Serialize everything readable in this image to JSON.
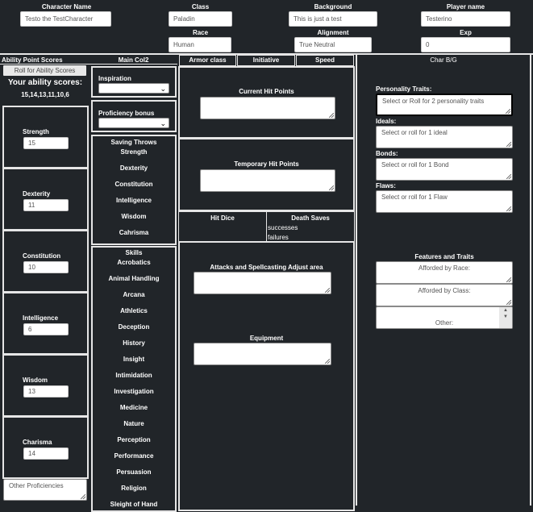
{
  "header": {
    "character_name": {
      "label": "Character Name",
      "value": "Testo the TestCharacter"
    },
    "class": {
      "label": "Class",
      "value": "Paladin"
    },
    "background": {
      "label": "Background",
      "value": "This is just a test"
    },
    "player_name": {
      "label": "Player name",
      "value": "Testerino"
    },
    "race": {
      "label": "Race",
      "value": "Human"
    },
    "alignment": {
      "label": "Alignment",
      "value": "True Neutral"
    },
    "exp": {
      "label": "Exp",
      "value": "0"
    }
  },
  "ability_col": {
    "title": "Ability Point Scores",
    "roll_button": "Roll for Ability Scores",
    "your_scores_label": "Your ability scores:",
    "scores_text": "15,14,13,11,10,6",
    "abilities": [
      {
        "name": "Strength",
        "value": "15"
      },
      {
        "name": "Dexterity",
        "value": "11"
      },
      {
        "name": "Constitution",
        "value": "10"
      },
      {
        "name": "Intelligence",
        "value": "6"
      },
      {
        "name": "Wisdom",
        "value": "13"
      },
      {
        "name": "Charisma",
        "value": "14"
      }
    ],
    "other_proficiencies_placeholder": "Other Proficiencies"
  },
  "main_col2": {
    "title": "Main Col2",
    "inspiration_label": "Inspiration",
    "proficiency_label": "Proficiency bonus",
    "saving_throws_title": "Saving Throws",
    "saving_throws": [
      "Strength",
      "Dexterity",
      "Constitution",
      "Intelligence",
      "Wisdom",
      "Cahrisma"
    ],
    "skills_title": "Skills",
    "skills": [
      "Acrobatics",
      "Animal Handling",
      "Arcana",
      "Athletics",
      "Deception",
      "History",
      "Insight",
      "Intimidation",
      "Investigation",
      "Medicine",
      "Nature",
      "Perception",
      "Performance",
      "Persuasion",
      "Religion",
      "Sleight of Hand"
    ]
  },
  "combat": {
    "armor_class": "Armor class",
    "initiative": "Initiative",
    "speed": "Speed",
    "current_hp": "Current Hit Points",
    "temp_hp": "Temporary Hit Points",
    "hit_dice": "Hit Dice",
    "death_saves": "Death Saves",
    "successes": "successes",
    "failures": "failures",
    "attacks": "Attacks and Spellcasting Adjust area",
    "equipment": "Equipment"
  },
  "char_bg": {
    "title": "Char B/G",
    "personality_label": "Personality Traits:",
    "personality_placeholder": "Select or Roll for 2 personality traits",
    "ideals_label": "Ideals:",
    "ideals_placeholder": "Select or roll for 1 ideal",
    "bonds_label": "Bonds:",
    "bonds_placeholder": "Select or roll for 1 Bond",
    "flaws_label": "Flaws:",
    "flaws_placeholder": "Select or roll for 1 Flaw",
    "features_title": "Features and Traits",
    "race_placeholder": "Afforded by Race:",
    "class_placeholder": "Afforded by Class:",
    "other_placeholder": "Other:"
  }
}
